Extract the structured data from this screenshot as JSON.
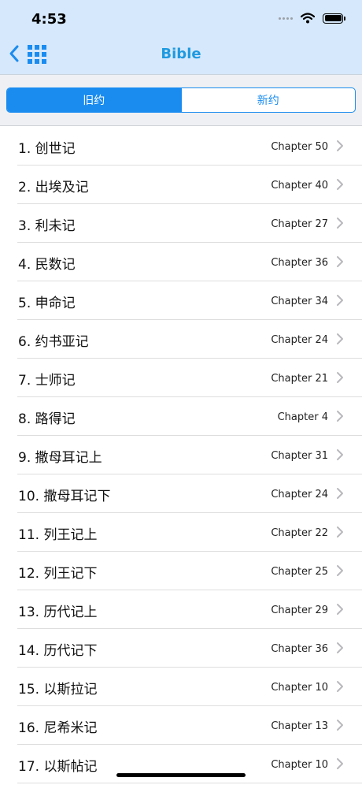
{
  "status_bar": {
    "time": "4:53"
  },
  "header": {
    "title": "Bible"
  },
  "segments": {
    "old": "旧约",
    "new": "新约",
    "selected": "old"
  },
  "books": [
    {
      "title": "1. 创世记",
      "chapter": "Chapter 50"
    },
    {
      "title": "2. 出埃及记",
      "chapter": "Chapter 40"
    },
    {
      "title": "3. 利未记",
      "chapter": "Chapter 27"
    },
    {
      "title": "4. 民数记",
      "chapter": "Chapter 36"
    },
    {
      "title": "5. 申命记",
      "chapter": "Chapter 34"
    },
    {
      "title": "6. 约书亚记",
      "chapter": "Chapter 24"
    },
    {
      "title": "7. 士师记",
      "chapter": "Chapter 21"
    },
    {
      "title": "8. 路得记",
      "chapter": "Chapter 4"
    },
    {
      "title": "9. 撒母耳记上",
      "chapter": "Chapter 31"
    },
    {
      "title": "10. 撒母耳记下",
      "chapter": "Chapter 24"
    },
    {
      "title": "11. 列王记上",
      "chapter": "Chapter 22"
    },
    {
      "title": "12. 列王记下",
      "chapter": "Chapter 25"
    },
    {
      "title": "13. 历代记上",
      "chapter": "Chapter 29"
    },
    {
      "title": "14. 历代记下",
      "chapter": "Chapter 36"
    },
    {
      "title": "15. 以斯拉记",
      "chapter": "Chapter 10"
    },
    {
      "title": "16. 尼希米记",
      "chapter": "Chapter 13"
    },
    {
      "title": "17. 以斯帖记",
      "chapter": "Chapter 10"
    }
  ],
  "colors": {
    "accent": "#1a8cf0",
    "title": "#1e9ae0",
    "header_bg": "#d6e8fb"
  },
  "icons": {
    "back": "chevron-left-icon",
    "grid": "grid-icon",
    "row": "chevron-right-icon"
  }
}
